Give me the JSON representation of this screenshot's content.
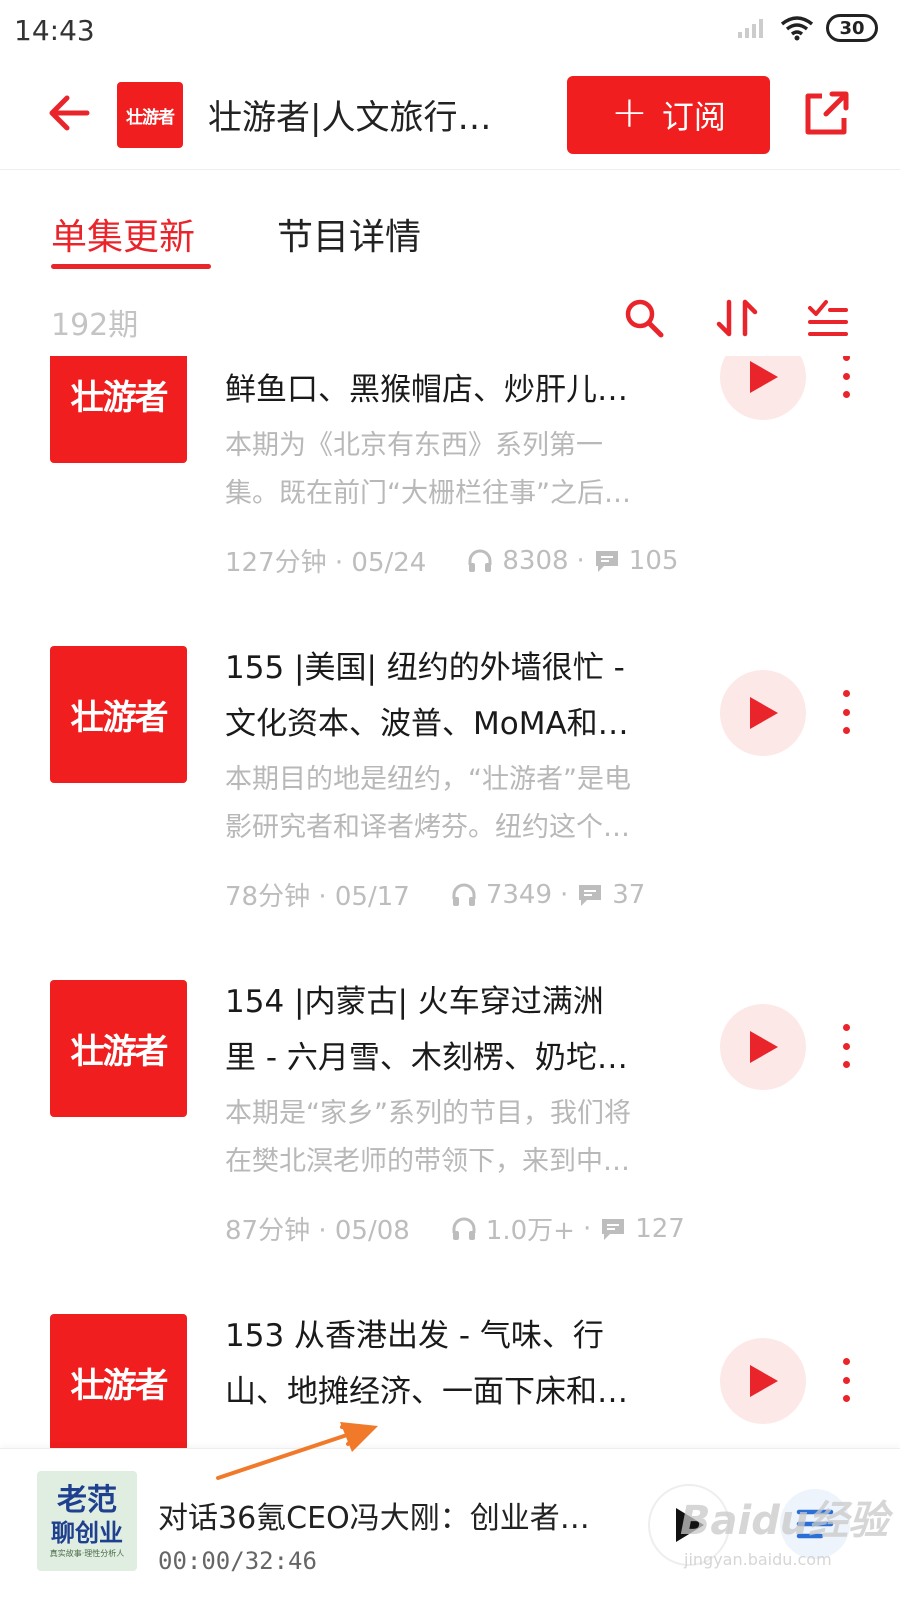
{
  "status_bar": {
    "time": "14:43",
    "battery": "30"
  },
  "header": {
    "logo_text": "壮游者",
    "title": "壮游者|人文旅行…",
    "subscribe_label": "订阅"
  },
  "tabs": [
    {
      "label": "单集更新",
      "active": true
    },
    {
      "label": "节目详情",
      "active": false
    }
  ],
  "list_toolbar": {
    "episode_count": "192期"
  },
  "episodes": [
    {
      "cover_text": "壮游者",
      "title_lines": [
        "鲜鱼口、黑猴帽店、炒肝儿…"
      ],
      "desc_lines": [
        "本期为《北京有东西》系列第一",
        "集。既在前门“大栅栏往事”之后…"
      ],
      "duration_date": "127分钟 · 05/24",
      "plays": "8308",
      "comments": "105"
    },
    {
      "cover_text": "壮游者",
      "title_lines": [
        "155 |美国| 纽约的外墙很忙 -",
        "文化资本、波普、MoMA和…"
      ],
      "desc_lines": [
        "本期目的地是纽约，“壮游者”是电",
        "影研究者和译者烤芬。纽约这个…"
      ],
      "duration_date": "78分钟 · 05/17",
      "plays": "7349",
      "comments": "37"
    },
    {
      "cover_text": "壮游者",
      "title_lines": [
        "154 |内蒙古| 火车穿过满洲",
        "里 - 六月雪、木刻楞、奶坨…"
      ],
      "desc_lines": [
        "本期是“家乡”系列的节目，我们将",
        "在樊北溟老师的带领下，来到中…"
      ],
      "duration_date": "87分钟 · 05/08",
      "plays": "1.0万+",
      "comments": "127"
    },
    {
      "cover_text": "壮游者",
      "title_lines": [
        "153 从香港出发 - 气味、行",
        "山、地摊经济、一面下床和…"
      ],
      "desc_lines": [],
      "duration_date": "",
      "plays": "",
      "comments": ""
    }
  ],
  "mini_player": {
    "cover_line1": "老范",
    "cover_line2": "聊创业",
    "cover_line3": "真实故事·理性分析人",
    "title": "对话36氪CEO冯大刚：创业者…",
    "time": "00:00/32:46"
  },
  "watermark": {
    "main": "Baidu经验",
    "sub": "jingyan.baidu.com"
  },
  "colors": {
    "accent": "#e9242a",
    "brand_red": "#f01e1e",
    "muted": "#bdbdbd"
  },
  "icons": {
    "back": "arrow-left-icon",
    "share": "share-icon",
    "search": "search-icon",
    "sort": "sort-icon",
    "filter": "filter-list-icon",
    "play": "play-icon",
    "more": "more-vertical-icon",
    "headphones": "headphones-icon",
    "comment": "comment-icon",
    "playlist": "playlist-icon"
  }
}
